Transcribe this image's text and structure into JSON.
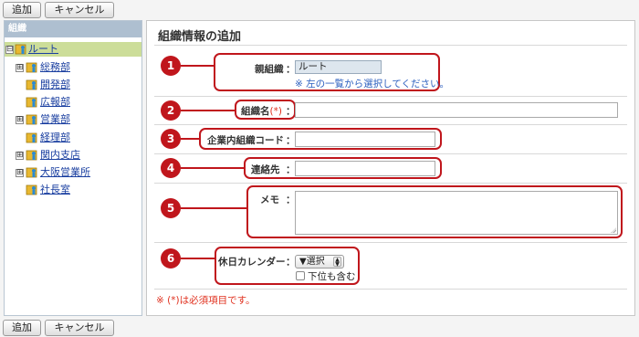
{
  "toolbar": {
    "add_label": "追加",
    "cancel_label": "キャンセル"
  },
  "tree": {
    "header": "組織",
    "items": [
      {
        "label": "ルート",
        "expander": "⊟",
        "selected": true
      },
      {
        "label": "総務部",
        "expander": "⊞"
      },
      {
        "label": "開発部"
      },
      {
        "label": "広報部"
      },
      {
        "label": "営業部",
        "expander": "⊞"
      },
      {
        "label": "経理部"
      },
      {
        "label": "関内支店",
        "expander": "⊞"
      },
      {
        "label": "大阪営業所",
        "expander": "⊞"
      },
      {
        "label": "社長室"
      }
    ]
  },
  "form": {
    "title": "組織情報の追加",
    "parent": {
      "num": "1",
      "label": "親組織",
      "value": "ルート",
      "note": "※ 左の一覧から選択してください。"
    },
    "name": {
      "num": "2",
      "label": "組織名",
      "required_mark": "(*)"
    },
    "code": {
      "num": "3",
      "label": "企業内組織コード"
    },
    "contact": {
      "num": "4",
      "label": "連絡先"
    },
    "memo": {
      "num": "5",
      "label": "メモ"
    },
    "calendar": {
      "num": "6",
      "label": "休日カレンダー",
      "select_value": "▼選択",
      "checkbox_label": "下位も含む"
    },
    "colon": "：",
    "required_note": "※ (*)は必須項目です。"
  },
  "colors": {
    "accent": "#c0161c",
    "link": "#1a3fa0",
    "note": "#2b5fbf",
    "selected_row": "#ccdd99"
  }
}
